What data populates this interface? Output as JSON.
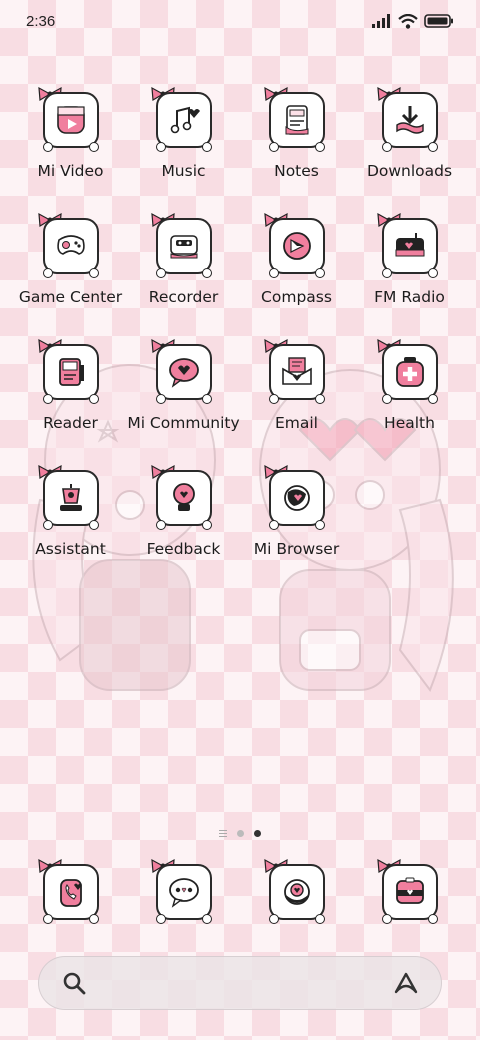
{
  "status_bar": {
    "time": "2:36",
    "icons": [
      "signal-icon",
      "wifi-icon",
      "battery-icon"
    ]
  },
  "apps": [
    {
      "label": "Mi Video",
      "icon": "video-icon"
    },
    {
      "label": "Music",
      "icon": "music-icon"
    },
    {
      "label": "Notes",
      "icon": "notes-icon"
    },
    {
      "label": "Downloads",
      "icon": "download-icon"
    },
    {
      "label": "Game Center",
      "icon": "gamepad-icon"
    },
    {
      "label": "Recorder",
      "icon": "recorder-icon"
    },
    {
      "label": "Compass",
      "icon": "compass-icon"
    },
    {
      "label": "FM Radio",
      "icon": "radio-icon"
    },
    {
      "label": "Reader",
      "icon": "reader-icon"
    },
    {
      "label": "Mi Community",
      "icon": "chat-heart-icon"
    },
    {
      "label": "Email",
      "icon": "email-icon"
    },
    {
      "label": "Health",
      "icon": "health-icon"
    },
    {
      "label": "Assistant",
      "icon": "assistant-icon"
    },
    {
      "label": "Feedback",
      "icon": "lightbulb-icon"
    },
    {
      "label": "Mi Browser",
      "icon": "browser-icon"
    }
  ],
  "page_indicator": {
    "pages": 2,
    "active": 2
  },
  "dock": [
    {
      "icon": "phone-icon"
    },
    {
      "icon": "messages-icon"
    },
    {
      "icon": "camera-icon"
    },
    {
      "icon": "gallery-icon"
    }
  ],
  "search_bar": {
    "left_icon": "search-icon",
    "right_icon": "assistant-a-icon"
  },
  "colors": {
    "accent_pink": "#f07f9e",
    "outline": "#2a2a2a",
    "checker": "#f8dde3"
  }
}
